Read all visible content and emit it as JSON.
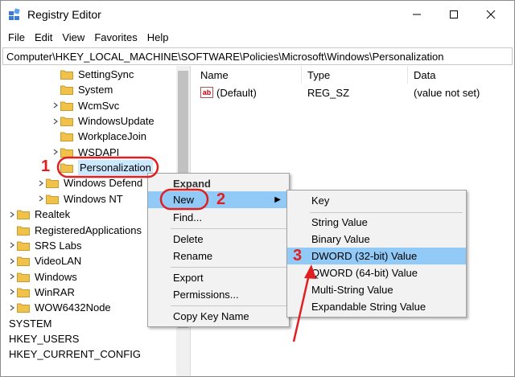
{
  "window": {
    "title": "Registry Editor"
  },
  "menubar": {
    "items": [
      "File",
      "Edit",
      "View",
      "Favorites",
      "Help"
    ]
  },
  "address": {
    "path": "Computer\\HKEY_LOCAL_MACHINE\\SOFTWARE\\Policies\\Microsoft\\Windows\\Personalization"
  },
  "tree": {
    "items": [
      {
        "label": "SettingSync",
        "expandable": false,
        "selected": false
      },
      {
        "label": "System",
        "expandable": false,
        "selected": false
      },
      {
        "label": "WcmSvc",
        "expandable": true,
        "selected": false
      },
      {
        "label": "WindowsUpdate",
        "expandable": true,
        "selected": false
      },
      {
        "label": "WorkplaceJoin",
        "expandable": false,
        "selected": false
      },
      {
        "label": "WSDAPI",
        "expandable": true,
        "selected": false
      },
      {
        "label": "Personalization",
        "expandable": false,
        "selected": true
      },
      {
        "label": "Windows Defend",
        "expandable": true,
        "selected": false
      },
      {
        "label": "Windows NT",
        "expandable": true,
        "selected": false
      },
      {
        "label": "Realtek",
        "expandable": true,
        "selected": false
      },
      {
        "label": "RegisteredApplications",
        "expandable": false,
        "selected": false
      },
      {
        "label": "SRS Labs",
        "expandable": true,
        "selected": false
      },
      {
        "label": "VideoLAN",
        "expandable": true,
        "selected": false
      },
      {
        "label": "Windows",
        "expandable": true,
        "selected": false
      },
      {
        "label": "WinRAR",
        "expandable": true,
        "selected": false
      },
      {
        "label": "WOW6432Node",
        "expandable": true,
        "selected": false
      },
      {
        "label": "SYSTEM",
        "expandable": true,
        "selected": false
      },
      {
        "label": "HKEY_USERS",
        "expandable": true,
        "selected": false
      },
      {
        "label": "HKEY_CURRENT_CONFIG",
        "expandable": true,
        "selected": false
      }
    ]
  },
  "list": {
    "columns": [
      "Name",
      "Type",
      "Data"
    ],
    "rows": [
      {
        "name": "(Default)",
        "type": "REG_SZ",
        "data": "(value not set)",
        "icon": "ab-icon"
      }
    ]
  },
  "context_menu": {
    "expand": "Expand",
    "new": "New",
    "find": "Find...",
    "delete": "Delete",
    "rename": "Rename",
    "export": "Export",
    "permissions": "Permissions...",
    "copy_key_name": "Copy Key Name"
  },
  "submenu": {
    "key": "Key",
    "string_value": "String Value",
    "binary_value": "Binary Value",
    "dword_value": "DWORD (32-bit) Value",
    "qword_value": "QWORD (64-bit) Value",
    "multi_string_value": "Multi-String Value",
    "expandable_string_value": "Expandable String Value"
  },
  "annotations": {
    "step1": "1",
    "step2": "2",
    "step3": "3",
    "color": "#e02020"
  },
  "colors": {
    "selection": "#cce8ff",
    "menu_highlight": "#91c9f7",
    "folder": "#f0c24a"
  }
}
